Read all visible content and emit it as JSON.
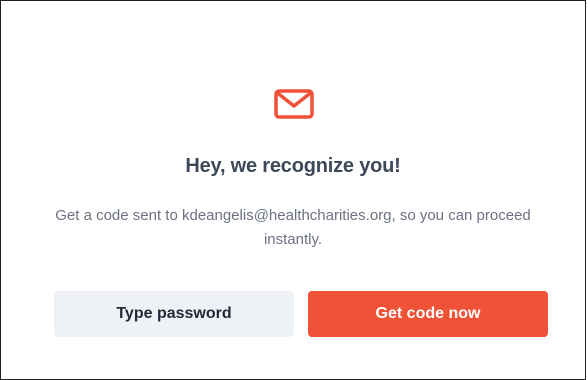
{
  "dialog": {
    "icon": "envelope-icon",
    "title": "Hey, we recognize you!",
    "message": "Get a code sent to kdeangelis@healthcharities.org, so you can proceed instantly.",
    "secondary_button": "Type password",
    "primary_button": "Get code now"
  },
  "colors": {
    "accent": "#ef5236",
    "title": "#3d4858",
    "message": "#6b7280",
    "secondary_bg": "#eef2f6"
  }
}
